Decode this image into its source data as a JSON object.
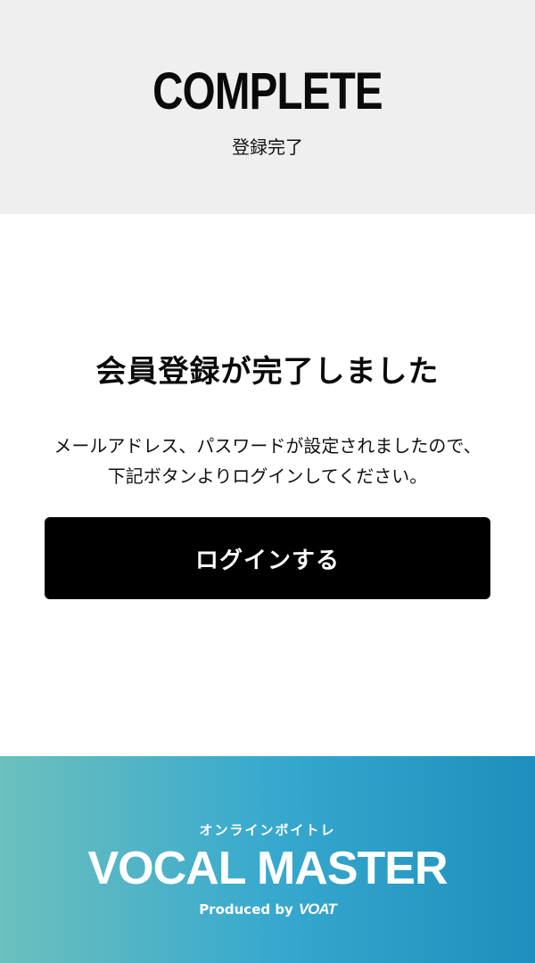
{
  "hero": {
    "title": "COMPLETE",
    "subtitle": "登録完了"
  },
  "main": {
    "heading": "会員登録が完了しました",
    "message_line1": "メールアドレス、パスワードが設定されましたので、",
    "message_line2": "下記ボタンよりログインしてください。",
    "login_button_label": "ログインする"
  },
  "footer": {
    "tagline": "オンラインボイトレ",
    "logo": "VOCAL MASTER",
    "produced_by": "Produced by",
    "producer_logo": "VOAT"
  },
  "colors": {
    "hero_background": "#efefef",
    "button_background": "#000000",
    "footer_gradient_start": "#6cc0bd",
    "footer_gradient_end": "#1c8fbd"
  }
}
